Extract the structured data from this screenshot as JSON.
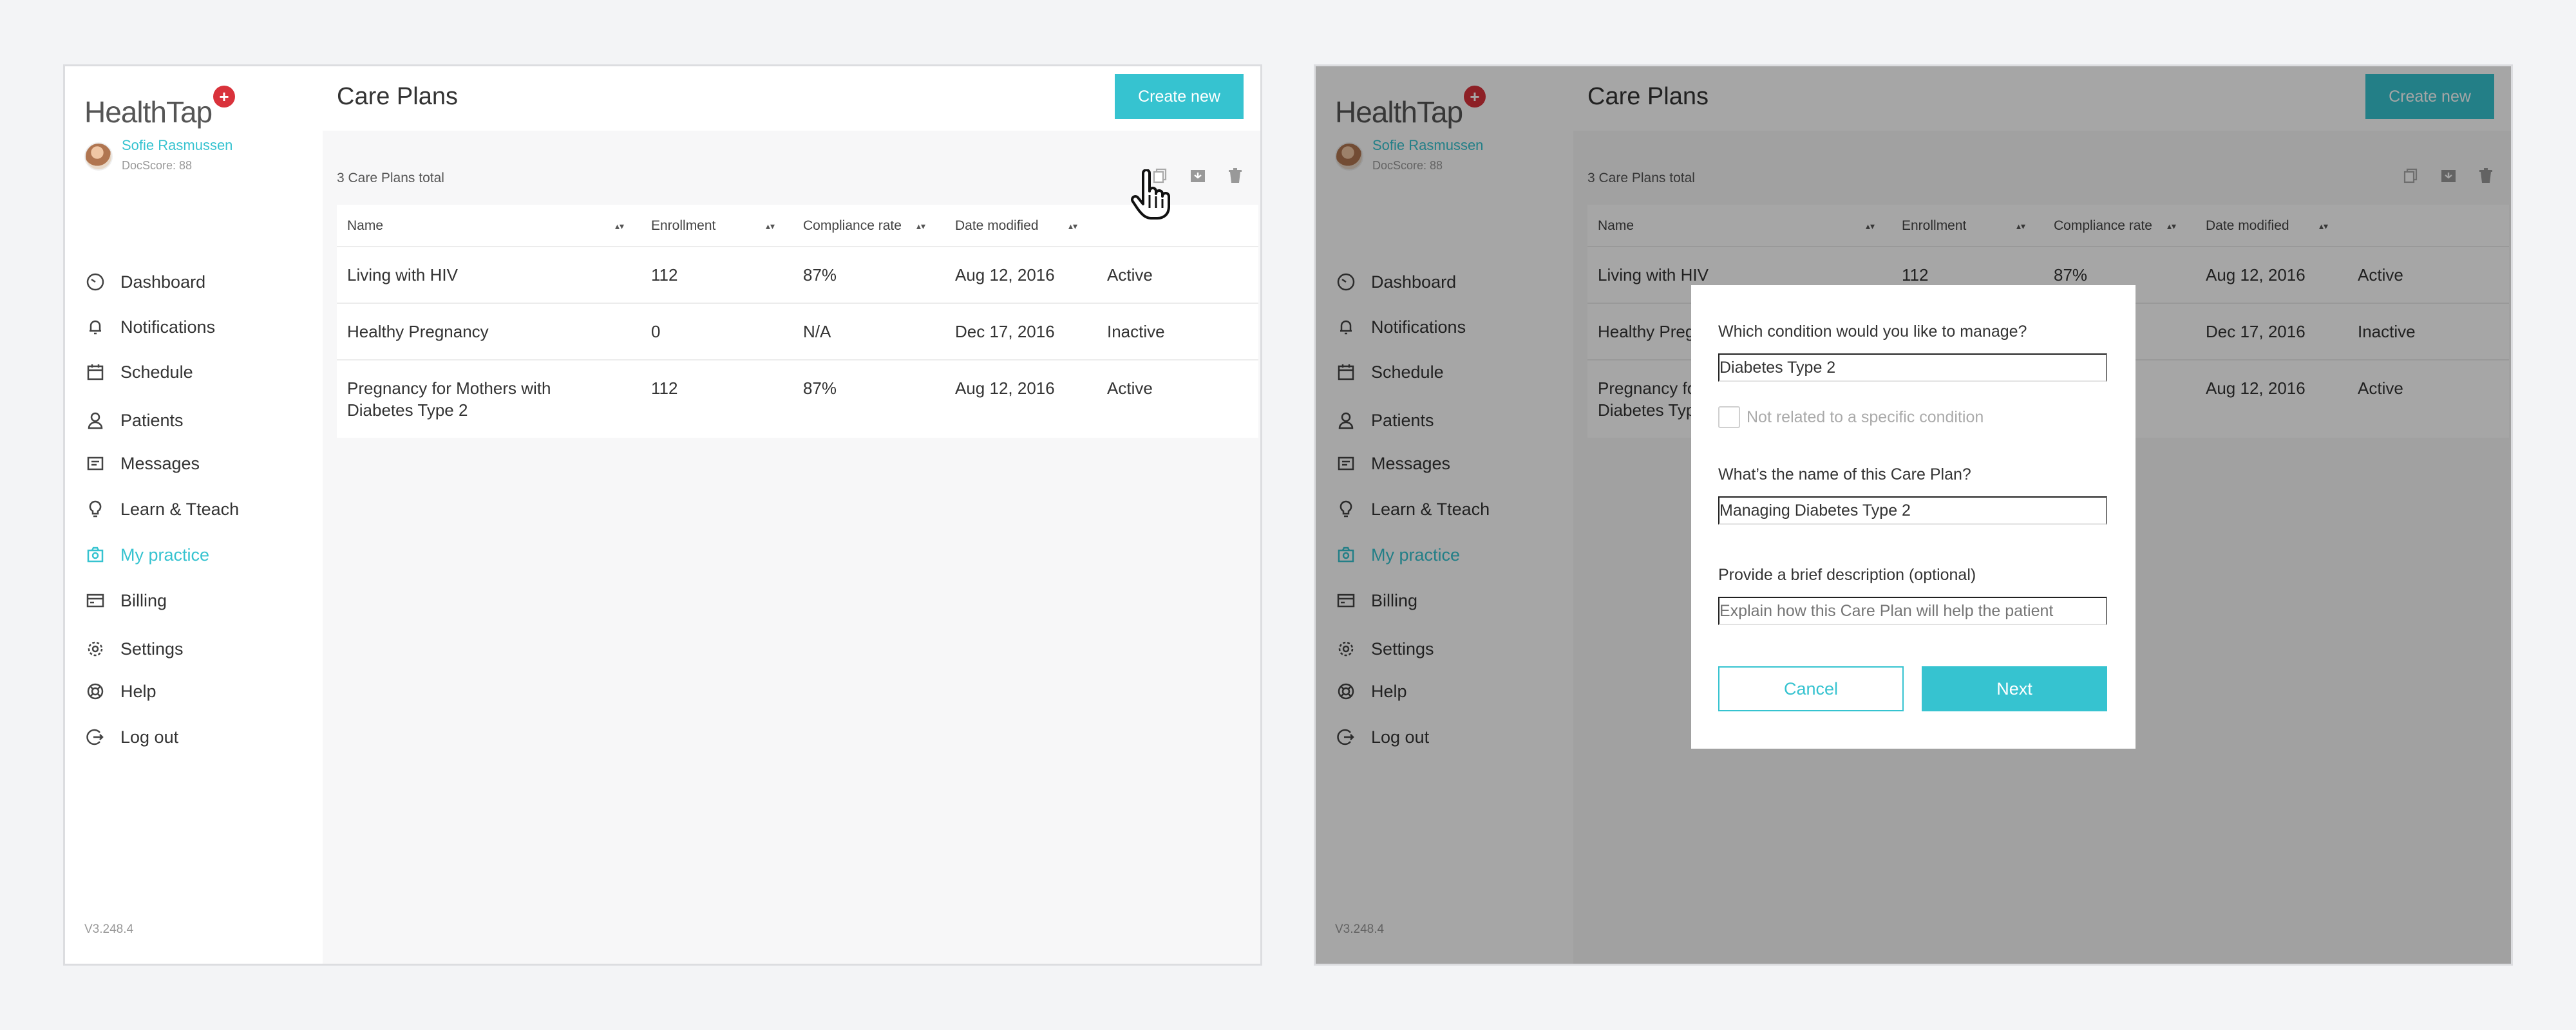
{
  "app": {
    "logo_text": "HealthTap",
    "user_name": "Sofie Rasmussen",
    "docscore": "DocScore: 88",
    "version": "V3.248.4"
  },
  "nav": [
    {
      "label": "Dashboard",
      "icon": "dashboard-icon"
    },
    {
      "label": "Notifications",
      "icon": "bell-icon"
    },
    {
      "label": "Schedule",
      "icon": "calendar-icon"
    },
    {
      "label": "Patients",
      "icon": "person-icon"
    },
    {
      "label": "Messages",
      "icon": "message-icon"
    },
    {
      "label": "Learn & Tteach",
      "icon": "lightbulb-icon"
    },
    {
      "label": "My practice",
      "icon": "camera-icon",
      "active": true
    },
    {
      "label": "Billing",
      "icon": "billing-icon"
    },
    {
      "label": "Settings",
      "icon": "gear-icon"
    },
    {
      "label": "Help",
      "icon": "lifebuoy-icon"
    },
    {
      "label": "Log out",
      "icon": "logout-icon"
    }
  ],
  "page": {
    "title": "Care Plans",
    "create_label": "Create new",
    "count_label": "3 Care Plans total"
  },
  "table": {
    "columns": [
      "Name",
      "Enrollment",
      "Compliance rate",
      "Date modified"
    ],
    "rows": [
      {
        "name": "Living with HIV",
        "enrollment": "112",
        "compliance": "87%",
        "date": "Aug 12, 2016",
        "status": "Active"
      },
      {
        "name": "Healthy Pregnancy",
        "enrollment": "0",
        "compliance": "N/A",
        "date": "Dec 17, 2016",
        "status": "Inactive"
      },
      {
        "name_line1": "Pregnancy for Mothers with",
        "name_line2": "Diabetes Type 2",
        "enrollment": "112",
        "compliance": "87%",
        "date": "Aug 12, 2016",
        "status": "Active"
      }
    ]
  },
  "modal": {
    "q1": "Which condition would you like to manage?",
    "condition_value": "Diabetes Type 2",
    "checkbox_label": "Not related to a specific condition",
    "q2": "What’s the name of this Care Plan?",
    "name_value": "Managing Diabetes Type 2",
    "q3": "Provide a brief description (optional)",
    "desc_placeholder": "Explain how this Care Plan will help the patient",
    "cancel_label": "Cancel",
    "next_label": "Next"
  },
  "colors": {
    "accent": "#36c3d0",
    "logo_red": "#d9323b"
  }
}
